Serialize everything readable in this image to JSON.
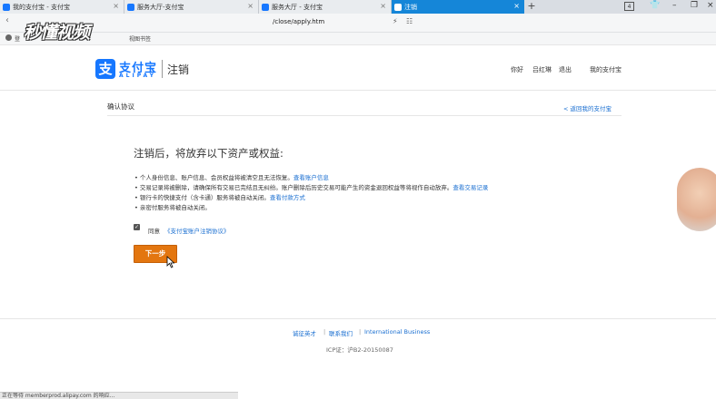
{
  "browser": {
    "tabs": [
      {
        "title": "我的支付宝 - 支付宝",
        "active": false
      },
      {
        "title": "服务大厅-支付宝",
        "active": false
      },
      {
        "title": "服务大厅 - 支付宝",
        "active": false
      },
      {
        "title": "注销",
        "active": true
      }
    ],
    "new_tab_label": "+",
    "tab_count": "4",
    "url": "/close/apply.htm",
    "bookmark_login": "登",
    "bookmark_item": "视图书签",
    "watermark": "秒懂视频",
    "status_text": "正在等待 memberprod.alipay.com 的响应..."
  },
  "header": {
    "logo_cn": "支付宝",
    "logo_en": "ALIPAY",
    "logo_icon_char": "支",
    "page_name": "注销",
    "nav": [
      "你好",
      "吕红琳",
      "退出",
      "我的支付宝"
    ]
  },
  "subheader": {
    "title": "确认协议",
    "back_link": "< 返回我的支付宝"
  },
  "main": {
    "heading": "注销后，将放弃以下资产或权益:",
    "bullets": [
      {
        "text": "• 个人身份信息、账户信息、会员权益将被清空且无法恢复。",
        "link": "查看账户信息"
      },
      {
        "text": "• 交易记录将被删除，请确保所有交易已完结且无纠纷。账户删除后历史交易可能产生的资金退回权益等将视作自动放弃。",
        "link": "查看交易记录"
      },
      {
        "text": "• 银行卡的快捷支付（含卡通）服务将被自动关闭。",
        "link": "查看付款方式"
      },
      {
        "text": "• 亲密付服务将被自动关闭。",
        "link": ""
      }
    ],
    "agree_prefix": "同意",
    "agree_link": "《支付宝账户注销协议》",
    "agree_checked": true,
    "next_button": "下一步"
  },
  "footer": {
    "links": [
      "诚征英才",
      "联系我们",
      "International Business"
    ],
    "separator": "|",
    "icp": "ICP证：沪B2-20150087"
  },
  "colors": {
    "brand_blue": "#1677ff",
    "link_blue": "#1a6fd1",
    "button_orange": "#e3760f",
    "active_tab": "#1586d8"
  }
}
